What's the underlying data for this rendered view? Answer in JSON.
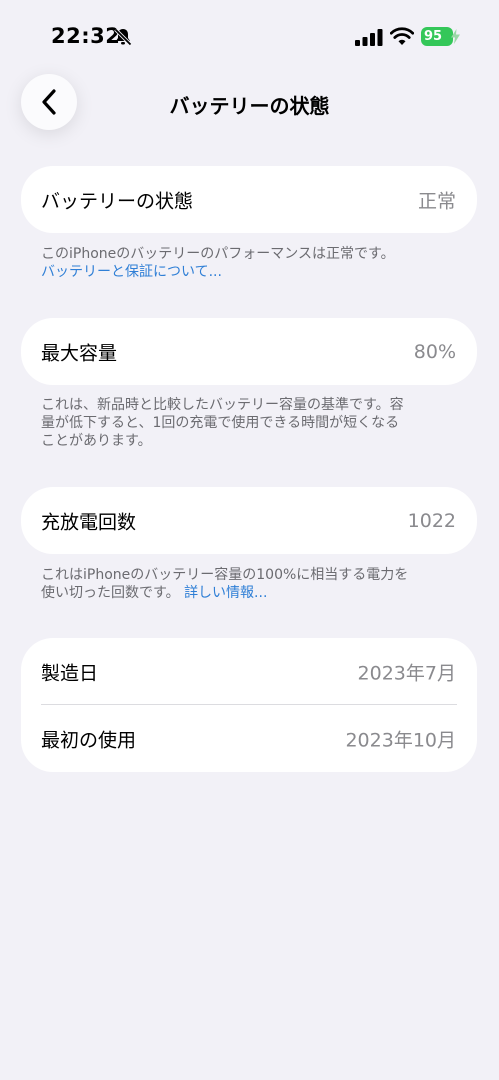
{
  "status_bar": {
    "time": "22:32",
    "battery_level": "95"
  },
  "nav": {
    "title": "バッテリーの状態"
  },
  "health": {
    "label": "バッテリーの状態",
    "value": "正常",
    "note": "このiPhoneのバッテリーのパフォーマンスは正常です。",
    "link": "バッテリーと保証について..."
  },
  "max_capacity": {
    "label": "最大容量",
    "value": "80%",
    "note_line1": "これは、新品時と比較したバッテリー容量の基準です。容",
    "note_line2": "量が低下すると、1回の充電で使用できる時間が短くなる",
    "note_line3": "ことがあります。"
  },
  "cycle_count": {
    "label": "充放電回数",
    "value": "1022",
    "note_line1": "これはiPhoneのバッテリー容量の100%に相当する電力を",
    "note_line2": "使い切った回数です。",
    "link": "詳しい情報..."
  },
  "dates": {
    "manufactured_label": "製造日",
    "manufactured_value": "2023年7月",
    "first_use_label": "最初の使用",
    "first_use_value": "2023年10月"
  },
  "colors": {
    "background": "#f2f1f7",
    "link": "#2f7fd6",
    "battery": "#34c759"
  }
}
